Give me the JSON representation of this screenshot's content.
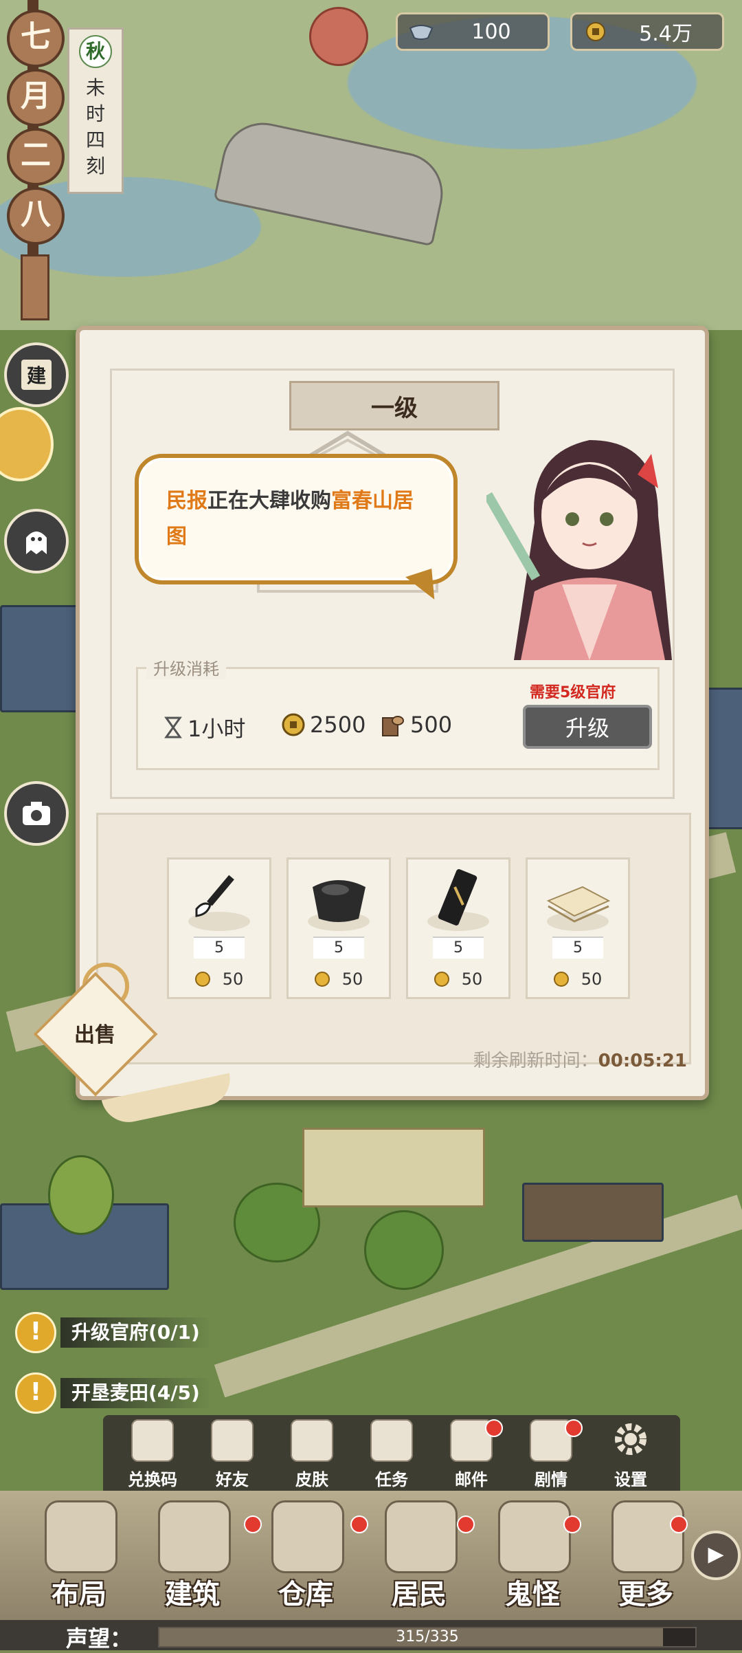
{
  "top_bar": {
    "silver": "100",
    "copper": "5.4万",
    "icons": [
      "silver-ingot-icon",
      "copper-coin-icon"
    ]
  },
  "calendar": {
    "month_chars": [
      "七",
      "月",
      "二",
      "八"
    ],
    "season": "秋",
    "time_label": "未时四刻"
  },
  "side_buttons": {
    "build_label": "建",
    "camera_icon": "camera-icon",
    "ghost_icon": "ghost-icon"
  },
  "panel": {
    "level": "一级",
    "bubble": {
      "part1": "民报",
      "part2": "正在大肆收购",
      "part3": "富春山居图"
    },
    "cost": {
      "label": "升级消耗",
      "time": "1小时",
      "coins": "2500",
      "wood": "500",
      "requirement": "需要5级官府",
      "upgrade_button": "升级"
    },
    "goods": [
      {
        "name": "brush",
        "icon": "brush-icon",
        "qty": "5",
        "price": "50"
      },
      {
        "name": "inkstone",
        "icon": "inkstone-icon",
        "qty": "5",
        "price": "50"
      },
      {
        "name": "ink-stick",
        "icon": "ink-stick-icon",
        "qty": "5",
        "price": "50"
      },
      {
        "name": "paper",
        "icon": "paper-stack-icon",
        "qty": "5",
        "price": "50"
      }
    ],
    "refresh_label": "剩余刷新时间：",
    "refresh_time": "00:05:21",
    "sell_label": "出售"
  },
  "quests": [
    {
      "text": "升级官府(0/1)"
    },
    {
      "text": "开垦麦田(4/5)"
    }
  ],
  "toolbar": [
    {
      "label": "兑换码",
      "icon": "redeem-code-icon",
      "dot": false
    },
    {
      "label": "好友",
      "icon": "friends-icon",
      "dot": false
    },
    {
      "label": "皮肤",
      "icon": "skin-icon",
      "dot": false
    },
    {
      "label": "任务",
      "icon": "task-icon",
      "dot": false
    },
    {
      "label": "邮件",
      "icon": "mail-icon",
      "dot": true
    },
    {
      "label": "剧情",
      "icon": "story-icon",
      "dot": true
    },
    {
      "label": "设置",
      "icon": "gear-icon",
      "dot": false
    }
  ],
  "bottom_nav": [
    {
      "label": "布局",
      "dot": false
    },
    {
      "label": "建筑",
      "dot": true
    },
    {
      "label": "仓库",
      "dot": true
    },
    {
      "label": "居民",
      "dot": true
    },
    {
      "label": "鬼怪",
      "dot": true
    },
    {
      "label": "更多",
      "dot": true
    }
  ],
  "reputation": {
    "label": "声望：",
    "value": "315/335",
    "fraction": 0.94
  }
}
